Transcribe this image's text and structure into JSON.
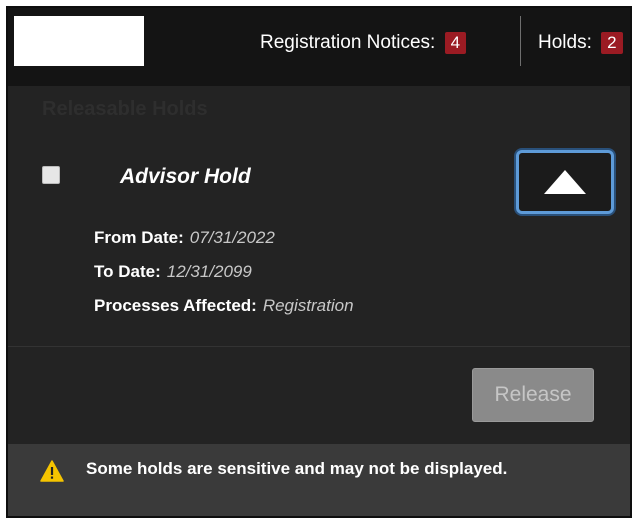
{
  "header": {
    "registration_notices_label": "Registration Notices:",
    "registration_notices_count": "4",
    "holds_label": "Holds:",
    "holds_count": "2"
  },
  "section": {
    "title": "Releasable Holds"
  },
  "hold": {
    "name": "Advisor Hold",
    "from_date_label": "From Date:",
    "from_date_value": "07/31/2022",
    "to_date_label": "To Date:",
    "to_date_value": "12/31/2099",
    "processes_label": "Processes Affected:",
    "processes_value": "Registration"
  },
  "actions": {
    "release_label": "Release"
  },
  "footer": {
    "message": "Some holds are sensitive and may not be displayed."
  },
  "icons": {
    "collapse": "chevron-up-icon",
    "warning": "warning-icon"
  },
  "colors": {
    "badge": "#9b1b23",
    "focus_ring": "#5e9bd8",
    "warning": "#f5c400",
    "panel_bg": "#232323"
  }
}
